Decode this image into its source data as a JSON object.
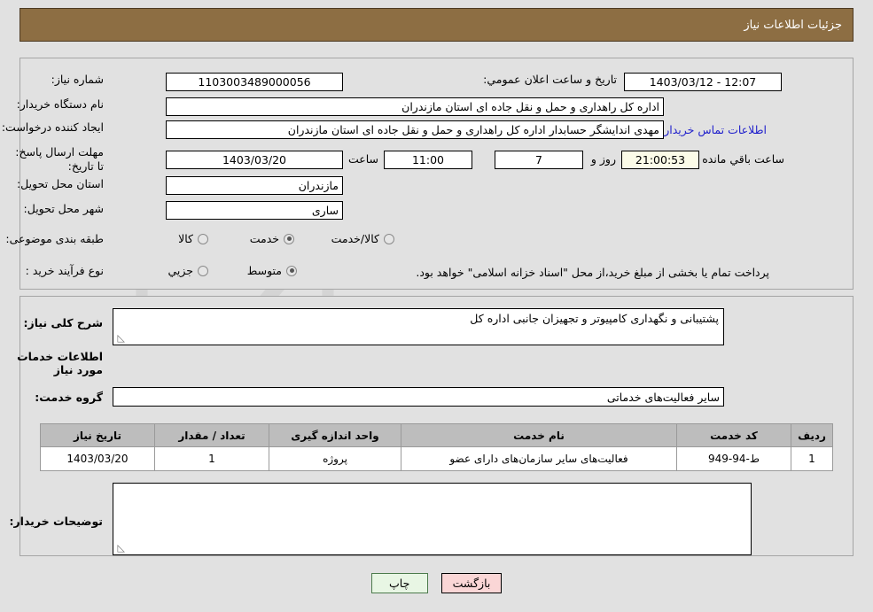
{
  "header": {
    "title": "جزئیات اطلاعات نیاز"
  },
  "form": {
    "need_number_label": "شماره نیاز:",
    "need_number_value": "1103003489000056",
    "announce_label": "تاریخ و ساعت اعلان عمومي:",
    "announce_value": "1403/03/12 - 12:07",
    "buyer_org_label": "نام دستگاه خریدار:",
    "buyer_org_value": "اداره کل راهداری و حمل و نقل جاده ای استان مازندران",
    "creator_label": "ایجاد کننده درخواست:",
    "creator_value": "مهدی اندایشگر حسابدار اداره کل راهداری و حمل و نقل جاده ای استان مازندران",
    "contact_link": "اطلاعات تماس خریدار",
    "deadline_label": "مهلت ارسال پاسخ: تا تاریخ:",
    "deadline_date": "1403/03/20",
    "hour_label": "ساعت",
    "hour_value": "11:00",
    "days_value": "7",
    "days_and_label": "روز و",
    "countdown_value": "21:00:53",
    "remaining_label": "ساعت باقي مانده",
    "province_label": "استان محل تحویل:",
    "province_value": "مازندران",
    "city_label": "شهر محل تحویل:",
    "city_value": "ساری",
    "category_label": "طبقه بندی موضوعی:",
    "category_options": [
      {
        "label": "کالا",
        "selected": false
      },
      {
        "label": "خدمت",
        "selected": true
      },
      {
        "label": "کالا/خدمت",
        "selected": false
      }
    ],
    "process_label": "نوع فرآیند خرید :",
    "process_options": [
      {
        "label": "جزیي",
        "selected": false
      },
      {
        "label": "متوسط",
        "selected": true
      }
    ],
    "process_note": "پرداخت تمام یا بخشی از مبلغ خرید،از محل \"اسناد خزانه اسلامی\" خواهد بود."
  },
  "description": {
    "label": "شرح کلی نیاز:",
    "value": "پشتیبانی و نگهداری کامپیوتر و تجهیزان جانبی اداره کل",
    "resize_glyph": "◺"
  },
  "services": {
    "heading": "اطلاعات خدمات مورد نیاز",
    "group_label": "گروه خدمت:",
    "group_value": "سایر فعالیت‌های خدماتی"
  },
  "table": {
    "columns": [
      "ردیف",
      "کد خدمت",
      "نام خدمت",
      "واحد اندازه گیری",
      "تعداد / مقدار",
      "تاریخ نیاز"
    ],
    "rows": [
      {
        "radif": "1",
        "code": "ط-94-949",
        "name": "فعالیت‌های سایر سازمان‌های دارای عضو",
        "unit": "پروژه",
        "qty": "1",
        "date": "1403/03/20"
      }
    ]
  },
  "buyer_notes": {
    "label": "توضیحات خریدار:",
    "value": "",
    "resize_glyph": "◺"
  },
  "buttons": {
    "back": "بازگشت",
    "print": "چاپ"
  },
  "watermark": {
    "text": "AriaTender.net"
  },
  "colors": {
    "header_bg": "#8d6e43",
    "page_bg": "#e1e1e1",
    "link": "#2222cc",
    "table_header_bg": "#bdbdbd",
    "btn_back_bg": "#fad6d6",
    "btn_print_bg": "#e8f6e4",
    "countdown_bg": "#fbfbe8"
  }
}
